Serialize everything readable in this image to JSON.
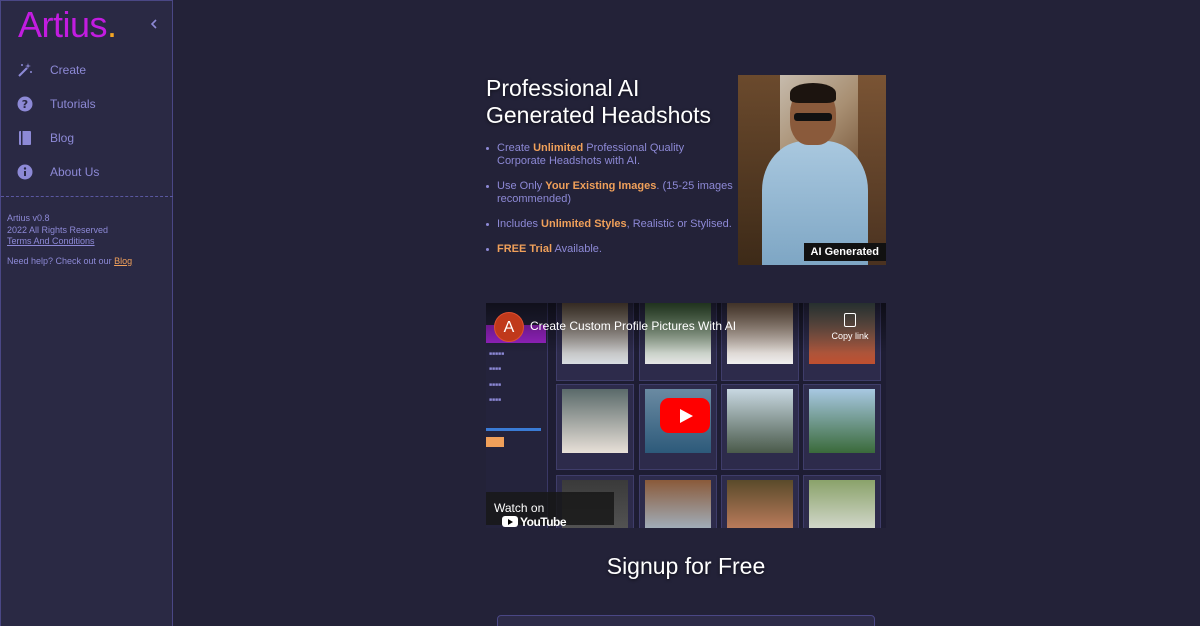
{
  "sidebar": {
    "brand": "Artius",
    "brand_dot": ".",
    "items": [
      {
        "label": "Create",
        "icon": "magic-wand-icon"
      },
      {
        "label": "Tutorials",
        "icon": "question-circle-icon"
      },
      {
        "label": "Blog",
        "icon": "book-icon"
      },
      {
        "label": "About Us",
        "icon": "info-circle-icon"
      }
    ],
    "version": "Artius v0.8",
    "rights": "2022 All Rights Reserved",
    "terms": "Terms And Conditions",
    "help_text": "Need help? Check out our ",
    "help_link": "Blog"
  },
  "hero": {
    "title": "Professional AI Generated Headshots",
    "bullets": [
      {
        "pre": "Create ",
        "bold": "Unlimited",
        "post": " Professional Quality Corporate Headshots with AI."
      },
      {
        "pre": "Use Only ",
        "bold": "Your Existing Images",
        "post": ". (15-25 images recommended)"
      },
      {
        "pre": "Includes ",
        "bold": "Unlimited Styles",
        "post": ", Realistic or Stylised."
      },
      {
        "pre": "",
        "bold": "FREE Trial",
        "post": " Available."
      }
    ],
    "image_badge": "AI Generated"
  },
  "video": {
    "channel_initial": "A",
    "title": "Create Custom Profile Pictures With AI",
    "copy_label": "Copy link",
    "watch_on": "Watch on",
    "youtube": "YouTube"
  },
  "signup": {
    "title": "Signup for Free"
  },
  "colors": {
    "background": "#232238",
    "sidebar": "#2a2944",
    "brand": "#c21ce0",
    "accent": "#f0a05a",
    "muted": "#8d89d6"
  }
}
